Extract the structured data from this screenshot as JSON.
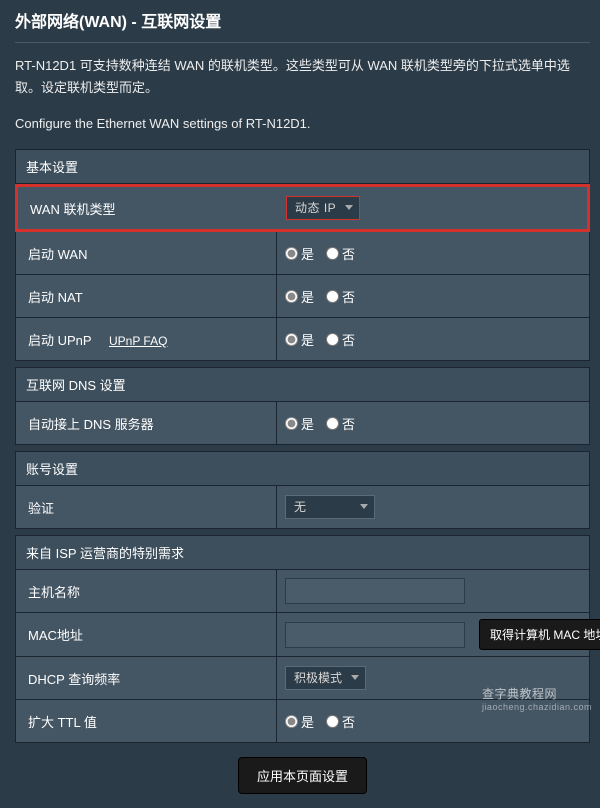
{
  "page": {
    "title": "外部网络(WAN) - 互联网设置",
    "intro1": "RT-N12D1 可支持数种连结 WAN 的联机类型。这些类型可从 WAN 联机类型旁的下拉式选单中选取。设定联机类型而定。",
    "intro2": "Configure the Ethernet WAN settings of RT-N12D1."
  },
  "sections": {
    "basic": "基本设置",
    "dns": "互联网 DNS 设置",
    "account": "账号设置",
    "isp": "来自 ISP 运营商的特别需求"
  },
  "labels": {
    "wan_type": "WAN 联机类型",
    "enable_wan": "启动 WAN",
    "enable_nat": "启动 NAT",
    "enable_upnp": "启动 UPnP",
    "upnp_faq": "UPnP FAQ",
    "auto_dns": "自动接上 DNS 服务器",
    "auth": "验证",
    "host_name": "主机名称",
    "mac_addr": "MAC地址",
    "get_mac": "取得计算机 MAC 地址",
    "dhcp_freq": "DHCP 查询频率",
    "ttl": "扩大 TTL 值"
  },
  "options": {
    "wan_type_selected": "动态 IP",
    "auth_selected": "无",
    "dhcp_selected": "积极模式",
    "yes": "是",
    "no": "否"
  },
  "buttons": {
    "apply": "应用本页面设置"
  },
  "watermark": {
    "main": "查字典教程网",
    "sub": "jiaocheng.chazidian.com"
  }
}
